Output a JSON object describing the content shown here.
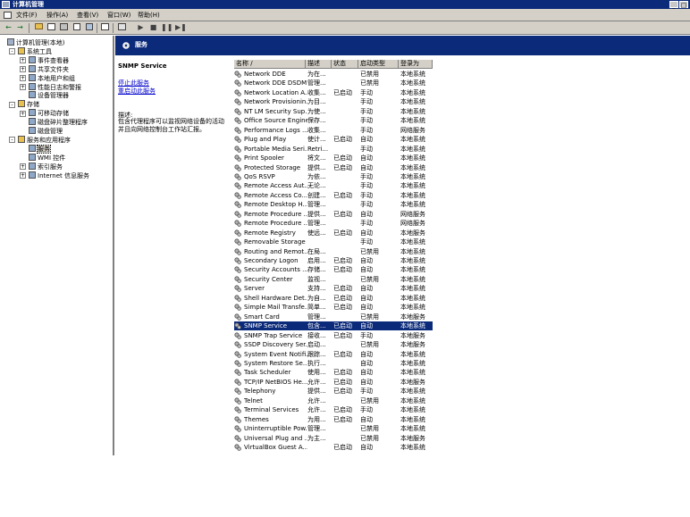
{
  "window": {
    "title": "计算机管理",
    "controls": [
      "_",
      "□"
    ]
  },
  "menu": [
    "文件(F)",
    "操作(A)",
    "查看(V)",
    "窗口(W)",
    "帮助(H)"
  ],
  "tree": [
    {
      "label": "计算机管理(本地)",
      "depth": 0,
      "exp": ""
    },
    {
      "label": "系统工具",
      "depth": 1,
      "exp": "-"
    },
    {
      "label": "事件查看器",
      "depth": 2,
      "exp": "+"
    },
    {
      "label": "共享文件夹",
      "depth": 2,
      "exp": "+"
    },
    {
      "label": "本地用户和组",
      "depth": 2,
      "exp": "+"
    },
    {
      "label": "性能日志和警报",
      "depth": 2,
      "exp": "+"
    },
    {
      "label": "设备管理器",
      "depth": 2,
      "exp": ""
    },
    {
      "label": "存储",
      "depth": 1,
      "exp": "-"
    },
    {
      "label": "可移动存储",
      "depth": 2,
      "exp": "+"
    },
    {
      "label": "磁盘碎片整理程序",
      "depth": 2,
      "exp": ""
    },
    {
      "label": "磁盘管理",
      "depth": 2,
      "exp": ""
    },
    {
      "label": "服务和应用程序",
      "depth": 1,
      "exp": "-"
    },
    {
      "label": "服务",
      "depth": 2,
      "exp": "",
      "selected": true
    },
    {
      "label": "WMI 控件",
      "depth": 2,
      "exp": ""
    },
    {
      "label": "索引服务",
      "depth": 2,
      "exp": "+"
    },
    {
      "label": "Internet 信息服务",
      "depth": 2,
      "exp": "+"
    }
  ],
  "header": {
    "title": "服务"
  },
  "detail": {
    "service_name": "SNMP Service",
    "stop_link": "停止此服务",
    "restart_link": "重启动此服务",
    "desc_label": "描述:",
    "desc_text": "包含代理程序可以监视网络设备的活动并且向网络控制台工作站汇报。"
  },
  "columns": [
    "名称 /",
    "描述",
    "状态",
    "启动类型",
    "登录为"
  ],
  "rows": [
    [
      "Network DDE",
      "为在...",
      "",
      "已禁用",
      "本地系统"
    ],
    [
      "Network DDE DSDM",
      "管理...",
      "",
      "已禁用",
      "本地系统"
    ],
    [
      "Network Location A...",
      "收集...",
      "已启动",
      "手动",
      "本地系统"
    ],
    [
      "Network Provisionin...",
      "为目...",
      "",
      "手动",
      "本地系统"
    ],
    [
      "NT LM Security Sup...",
      "为使...",
      "",
      "手动",
      "本地系统"
    ],
    [
      "Office Source Engine",
      "保存...",
      "",
      "手动",
      "本地系统"
    ],
    [
      "Performance Logs ...",
      "收集...",
      "",
      "手动",
      "网络服务"
    ],
    [
      "Plug and Play",
      "使计...",
      "已启动",
      "自动",
      "本地系统"
    ],
    [
      "Portable Media Seri...",
      "Retri...",
      "",
      "手动",
      "本地系统"
    ],
    [
      "Print Spooler",
      "将文...",
      "已启动",
      "自动",
      "本地系统"
    ],
    [
      "Protected Storage",
      "提供...",
      "已启动",
      "自动",
      "本地系统"
    ],
    [
      "QoS RSVP",
      "为依...",
      "",
      "手动",
      "本地系统"
    ],
    [
      "Remote Access Aut...",
      "无论...",
      "",
      "手动",
      "本地系统"
    ],
    [
      "Remote Access Co...",
      "创建...",
      "已启动",
      "手动",
      "本地系统"
    ],
    [
      "Remote Desktop H...",
      "管理...",
      "",
      "手动",
      "本地系统"
    ],
    [
      "Remote Procedure ...",
      "提供...",
      "已启动",
      "自动",
      "网络服务"
    ],
    [
      "Remote Procedure ...",
      "管理...",
      "",
      "手动",
      "网络服务"
    ],
    [
      "Remote Registry",
      "使远...",
      "已启动",
      "自动",
      "本地服务"
    ],
    [
      "Removable Storage",
      "",
      "",
      "手动",
      "本地系统"
    ],
    [
      "Routing and Remot...",
      "在局...",
      "",
      "已禁用",
      "本地系统"
    ],
    [
      "Secondary Logon",
      "启用...",
      "已启动",
      "自动",
      "本地系统"
    ],
    [
      "Security Accounts ...",
      "存储...",
      "已启动",
      "自动",
      "本地系统"
    ],
    [
      "Security Center",
      "监视...",
      "",
      "已禁用",
      "本地系统"
    ],
    [
      "Server",
      "支持...",
      "已启动",
      "自动",
      "本地系统"
    ],
    [
      "Shell Hardware Det...",
      "为自...",
      "已启动",
      "自动",
      "本地系统"
    ],
    [
      "Simple Mail Transfe...",
      "简单...",
      "已启动",
      "自动",
      "本地系统"
    ],
    [
      "Smart Card",
      "管理...",
      "",
      "已禁用",
      "本地服务"
    ],
    [
      "SNMP Service",
      "包含...",
      "已启动",
      "自动",
      "本地系统"
    ],
    [
      "SNMP Trap Service",
      "接收...",
      "已启动",
      "手动",
      "本地服务"
    ],
    [
      "SSDP Discovery Ser...",
      "启动...",
      "",
      "已禁用",
      "本地服务"
    ],
    [
      "System Event Notifi...",
      "跟踪...",
      "已启动",
      "自动",
      "本地系统"
    ],
    [
      "System Restore Se...",
      "执行...",
      "",
      "自动",
      "本地系统"
    ],
    [
      "Task Scheduler",
      "使用...",
      "已启动",
      "自动",
      "本地系统"
    ],
    [
      "TCP/IP NetBIOS He...",
      "允许...",
      "已启动",
      "自动",
      "本地服务"
    ],
    [
      "Telephony",
      "提供...",
      "已启动",
      "手动",
      "本地系统"
    ],
    [
      "Telnet",
      "允许...",
      "",
      "已禁用",
      "本地系统"
    ],
    [
      "Terminal Services",
      "允许...",
      "已启动",
      "手动",
      "本地系统"
    ],
    [
      "Themes",
      "为用...",
      "已启动",
      "自动",
      "本地系统"
    ],
    [
      "Uninterruptible Pow...",
      "管理...",
      "",
      "已禁用",
      "本地系统"
    ],
    [
      "Universal Plug and ...",
      "为主...",
      "",
      "已禁用",
      "本地服务"
    ],
    [
      "VirtualBox Guest A...",
      "",
      "已启动",
      "自动",
      "本地系统"
    ]
  ],
  "selected_row": 27,
  "colors": {
    "titlebar": "#0b2a7a",
    "face": "#d4d0c8",
    "selection": "#0b2a7a"
  }
}
